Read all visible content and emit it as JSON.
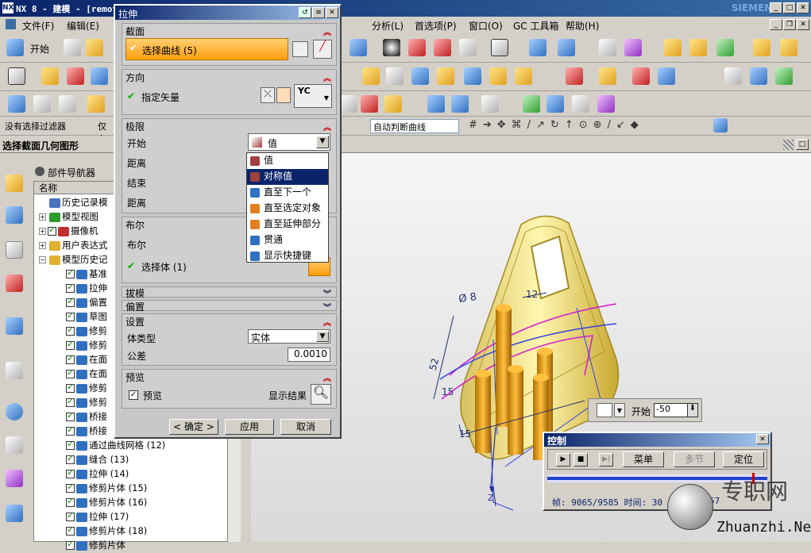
{
  "app": {
    "title": "NX 8 - 建模 - [remot",
    "brand": "SIEMENS"
  },
  "menu": [
    "文件(F)",
    "编辑(E)",
    "分析(L)",
    "首选项(P)",
    "窗口(O)",
    "GC 工具箱",
    "帮助(H)"
  ],
  "toolbar": {
    "start_label": "开始",
    "filter": "没有选择过滤器",
    "filter2": "仅在",
    "curve_rule": "自动判断曲线"
  },
  "cue_line": "选择截面几何图形",
  "navigator": {
    "title": "部件导航器",
    "col_name": "名称",
    "items": [
      {
        "label": "历史记录模",
        "indent": 1,
        "type": "clock"
      },
      {
        "label": "模型视图",
        "indent": 1,
        "type": "view"
      },
      {
        "label": "摄像机",
        "indent": 1,
        "type": "cam"
      },
      {
        "label": "用户表达式",
        "indent": 1,
        "type": "folder"
      },
      {
        "label": "模型历史记",
        "indent": 1,
        "type": "folder"
      },
      {
        "label": "基准",
        "indent": 2,
        "type": "feat"
      },
      {
        "label": "拉伸",
        "indent": 2,
        "type": "feat"
      },
      {
        "label": "偏置",
        "indent": 2,
        "type": "feat"
      },
      {
        "label": "草图",
        "indent": 2,
        "type": "feat"
      },
      {
        "label": "修剪",
        "indent": 2,
        "type": "feat"
      },
      {
        "label": "修剪",
        "indent": 2,
        "type": "feat"
      },
      {
        "label": "在面",
        "indent": 2,
        "type": "feat"
      },
      {
        "label": "在面",
        "indent": 2,
        "type": "feat"
      },
      {
        "label": "修剪",
        "indent": 2,
        "type": "feat"
      },
      {
        "label": "修剪",
        "indent": 2,
        "type": "feat"
      },
      {
        "label": "桥接",
        "indent": 2,
        "type": "feat"
      },
      {
        "label": "桥接",
        "indent": 2,
        "type": "feat"
      },
      {
        "label": "通过曲线网格 (12)",
        "indent": 2,
        "type": "feat"
      },
      {
        "label": "缝合 (13)",
        "indent": 2,
        "type": "feat"
      },
      {
        "label": "拉伸 (14)",
        "indent": 2,
        "type": "feat"
      },
      {
        "label": "修剪片体 (15)",
        "indent": 2,
        "type": "feat"
      },
      {
        "label": "修剪片体 (16)",
        "indent": 2,
        "type": "feat"
      },
      {
        "label": "拉伸 (17)",
        "indent": 2,
        "type": "feat"
      },
      {
        "label": "修剪片体 (18)",
        "indent": 2,
        "type": "feat"
      },
      {
        "label": "修剪片体",
        "indent": 2,
        "type": "feat"
      }
    ]
  },
  "dialog": {
    "title": "拉伸",
    "section": {
      "label": "截面",
      "select_curve": "选择曲线 (5)"
    },
    "direction": {
      "label": "方向",
      "vector": "指定矢量",
      "vector_value": "YC"
    },
    "limits": {
      "label": "极限",
      "start_label": "开始",
      "start_value": "值",
      "distance1": "距离",
      "end_label": "结束",
      "distance2": "距离"
    },
    "boolean": {
      "label": "布尔",
      "bool_label": "布尔",
      "select_body": "选择体 (1)"
    },
    "draft": "拔模",
    "offset": "偏置",
    "settings": {
      "label": "设置",
      "body_type_label": "体类型",
      "body_type": "实体",
      "tolerance_label": "公差",
      "tolerance": "0.0010"
    },
    "preview": {
      "label": "预览",
      "preview_check": "预览",
      "show_result": "显示结果"
    },
    "ok": "< 确定 >",
    "apply": "应用",
    "cancel": "取消"
  },
  "dropdown": {
    "items": [
      "值",
      "对称值",
      "直至下一个",
      "直至选定对象",
      "直至延伸部分",
      "贯通",
      "显示快捷键"
    ],
    "highlighted": 1
  },
  "onscreen": {
    "label": "开始",
    "value": "-50"
  },
  "dims": {
    "d8": "Ø 8",
    "d12": "12",
    "d52": "52",
    "d15a": "15",
    "d15b": "15",
    "axis": "Z"
  },
  "control": {
    "title": "控制",
    "menu": "菜单",
    "multi": "多节",
    "locate": "定位",
    "frame": "帧: 9065/9585 时间: 30",
    "frame_tail": "57"
  },
  "watermark": {
    "cn": "专职网",
    "en": "Zhuanzhi.Net"
  },
  "colors": {
    "title": "#0a246a",
    "accent": "#ffb400",
    "highlight": "#0a246a"
  }
}
